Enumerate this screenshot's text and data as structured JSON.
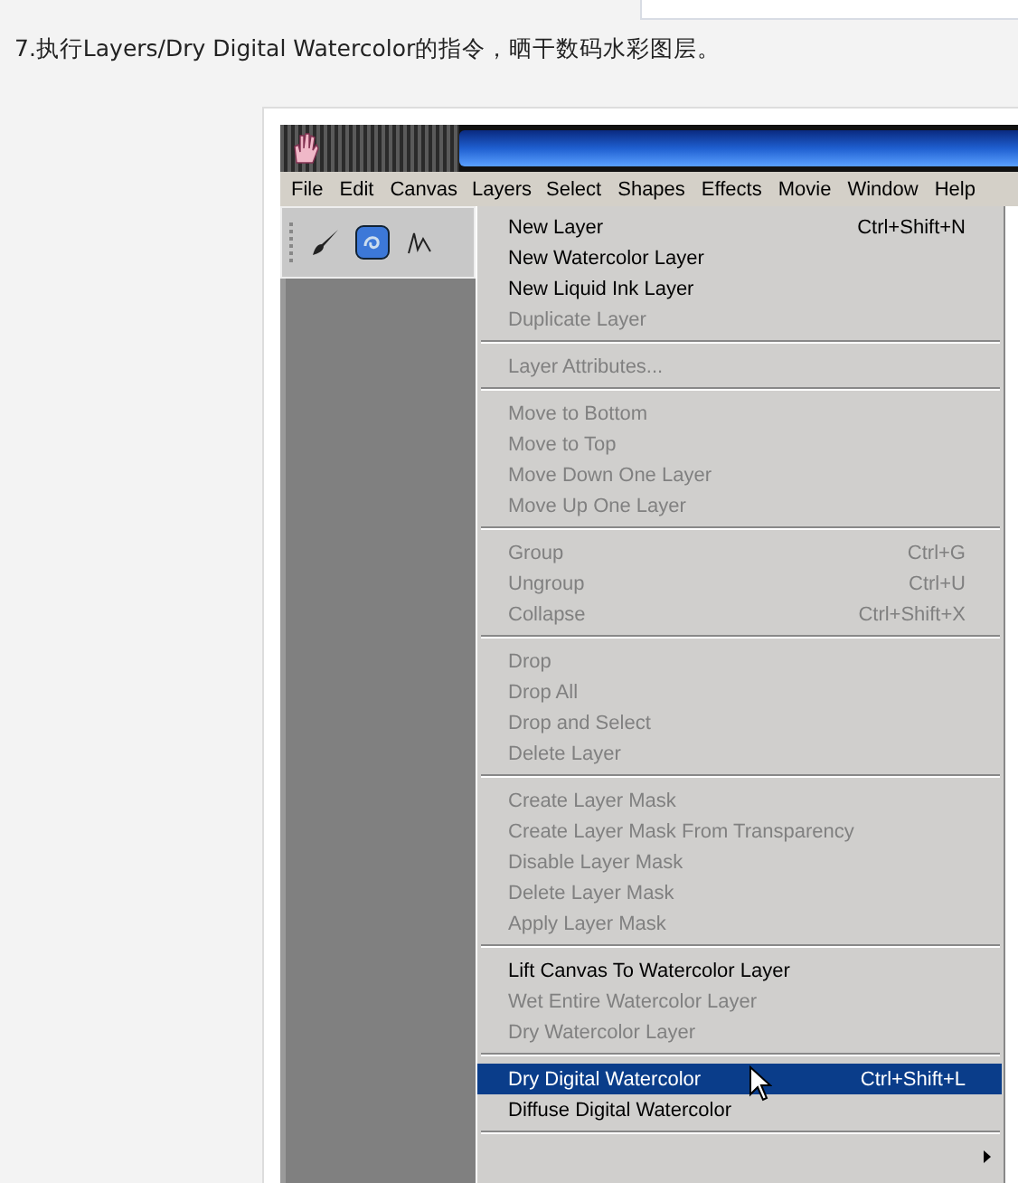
{
  "caption": "7.执行Layers/Dry Digital Watercolor的指令，晒干数码水彩图层。",
  "menubar": [
    {
      "label": "File",
      "selected": false
    },
    {
      "label": "Edit",
      "selected": false
    },
    {
      "label": "Canvas",
      "selected": false
    },
    {
      "label": "Layers",
      "selected": true
    },
    {
      "label": "Select",
      "selected": false
    },
    {
      "label": "Shapes",
      "selected": false
    },
    {
      "label": "Effects",
      "selected": false
    },
    {
      "label": "Movie",
      "selected": false
    },
    {
      "label": "Window",
      "selected": false
    },
    {
      "label": "Help",
      "selected": false
    }
  ],
  "menu_groups": [
    {
      "items": [
        {
          "kind": "item",
          "label": "New Layer",
          "shortcut": "Ctrl+Shift+N",
          "disabled": false,
          "selected": false
        },
        {
          "kind": "item",
          "label": "New Watercolor Layer",
          "disabled": false,
          "selected": false
        },
        {
          "kind": "item",
          "label": "New Liquid Ink Layer",
          "disabled": false,
          "selected": false
        },
        {
          "kind": "item",
          "label": "Duplicate Layer",
          "disabled": true,
          "selected": false
        }
      ]
    },
    {
      "items": [
        {
          "kind": "item",
          "label": "Layer Attributes...",
          "disabled": true,
          "selected": false
        }
      ]
    },
    {
      "items": [
        {
          "kind": "item",
          "label": "Move to Bottom",
          "disabled": true,
          "selected": false
        },
        {
          "kind": "item",
          "label": "Move to Top",
          "disabled": true,
          "selected": false
        },
        {
          "kind": "item",
          "label": "Move Down One Layer",
          "disabled": true,
          "selected": false
        },
        {
          "kind": "item",
          "label": "Move Up One Layer",
          "disabled": true,
          "selected": false
        }
      ]
    },
    {
      "items": [
        {
          "kind": "item",
          "label": "Group",
          "shortcut": "Ctrl+G",
          "disabled": true,
          "selected": false
        },
        {
          "kind": "item",
          "label": "Ungroup",
          "shortcut": "Ctrl+U",
          "disabled": true,
          "selected": false
        },
        {
          "kind": "item",
          "label": "Collapse",
          "shortcut": "Ctrl+Shift+X",
          "disabled": true,
          "selected": false
        }
      ]
    },
    {
      "items": [
        {
          "kind": "item",
          "label": "Drop",
          "disabled": true,
          "selected": false
        },
        {
          "kind": "item",
          "label": "Drop All",
          "disabled": true,
          "selected": false
        },
        {
          "kind": "item",
          "label": "Drop and Select",
          "disabled": true,
          "selected": false
        },
        {
          "kind": "item",
          "label": "Delete Layer",
          "disabled": true,
          "selected": false
        }
      ]
    },
    {
      "items": [
        {
          "kind": "item",
          "label": "Create Layer Mask",
          "disabled": true,
          "selected": false
        },
        {
          "kind": "item",
          "label": "Create Layer Mask From Transparency",
          "disabled": true,
          "selected": false
        },
        {
          "kind": "item",
          "label": "Disable Layer Mask",
          "disabled": true,
          "selected": false
        },
        {
          "kind": "item",
          "label": "Delete Layer Mask",
          "disabled": true,
          "selected": false
        },
        {
          "kind": "item",
          "label": "Apply Layer Mask",
          "disabled": true,
          "selected": false
        }
      ]
    },
    {
      "items": [
        {
          "kind": "item",
          "label": "Lift Canvas To Watercolor Layer",
          "disabled": false,
          "selected": false
        },
        {
          "kind": "item",
          "label": "Wet Entire Watercolor Layer",
          "disabled": true,
          "selected": false
        },
        {
          "kind": "item",
          "label": "Dry Watercolor Layer",
          "disabled": true,
          "selected": false
        }
      ]
    },
    {
      "items": [
        {
          "kind": "item",
          "label": "Dry Digital Watercolor",
          "shortcut": "Ctrl+Shift+L",
          "disabled": false,
          "selected": true
        },
        {
          "kind": "item",
          "label": "Diffuse Digital Watercolor",
          "disabled": false,
          "selected": false
        }
      ]
    },
    {
      "items": [
        {
          "kind": "submenu"
        }
      ]
    }
  ]
}
